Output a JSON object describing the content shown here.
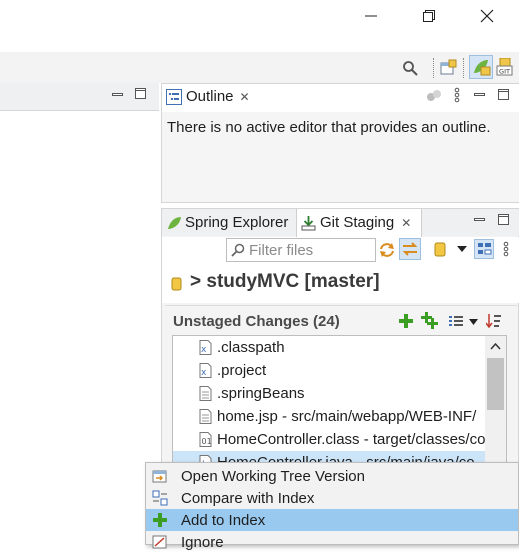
{
  "window": {
    "controls": [
      {
        "name": "minimize",
        "glyph": "—"
      },
      {
        "name": "restore",
        "glyph": "❐"
      },
      {
        "name": "close",
        "glyph": "✕"
      }
    ]
  },
  "toolbar": {
    "icons": [
      "search-icon",
      "open-perspective-icon",
      "spring-perspective-icon",
      "git-perspective-icon"
    ]
  },
  "outline": {
    "tab_label": "Outline",
    "close_glyph": "✕",
    "message": "There is no active editor that provides an outline."
  },
  "staging": {
    "tabs": [
      {
        "label": "Spring Explorer",
        "active": false
      },
      {
        "label": "Git Staging",
        "active": true
      }
    ],
    "close_glyph": "✕",
    "filter_placeholder": "Filter files",
    "repository_title": "> studyMVC [master]",
    "unstaged_header": "Unstaged Changes (24)",
    "files": [
      {
        "name": ".classpath",
        "icon": "text-file-icon"
      },
      {
        "name": ".project",
        "icon": "text-file-icon"
      },
      {
        "name": ".springBeans",
        "icon": "doc-file-icon"
      },
      {
        "name": "home.jsp - src/main/webapp/WEB-INF/",
        "icon": "doc-file-icon"
      },
      {
        "name": "HomeController.class - target/classes/co",
        "icon": "class-file-icon"
      },
      {
        "name": "HomeController.java - src/main/java/co",
        "icon": "java-file-icon",
        "selected": true
      }
    ]
  },
  "context_menu": {
    "items": [
      {
        "label": "Open Working Tree Version",
        "icon": "open-file-icon",
        "highlighted": false
      },
      {
        "label": "Compare with Index",
        "icon": "compare-icon",
        "highlighted": false
      },
      {
        "label": "Add to Index",
        "icon": "add-icon",
        "highlighted": true
      },
      {
        "label": "Ignore",
        "icon": "ignore-icon",
        "highlighted": false
      }
    ]
  },
  "colors": {
    "menu_highlight": "#99c9ef",
    "selection": "#cce4f7",
    "add_green": "#3c9d23",
    "repo_yellow": "#e8c23a"
  }
}
